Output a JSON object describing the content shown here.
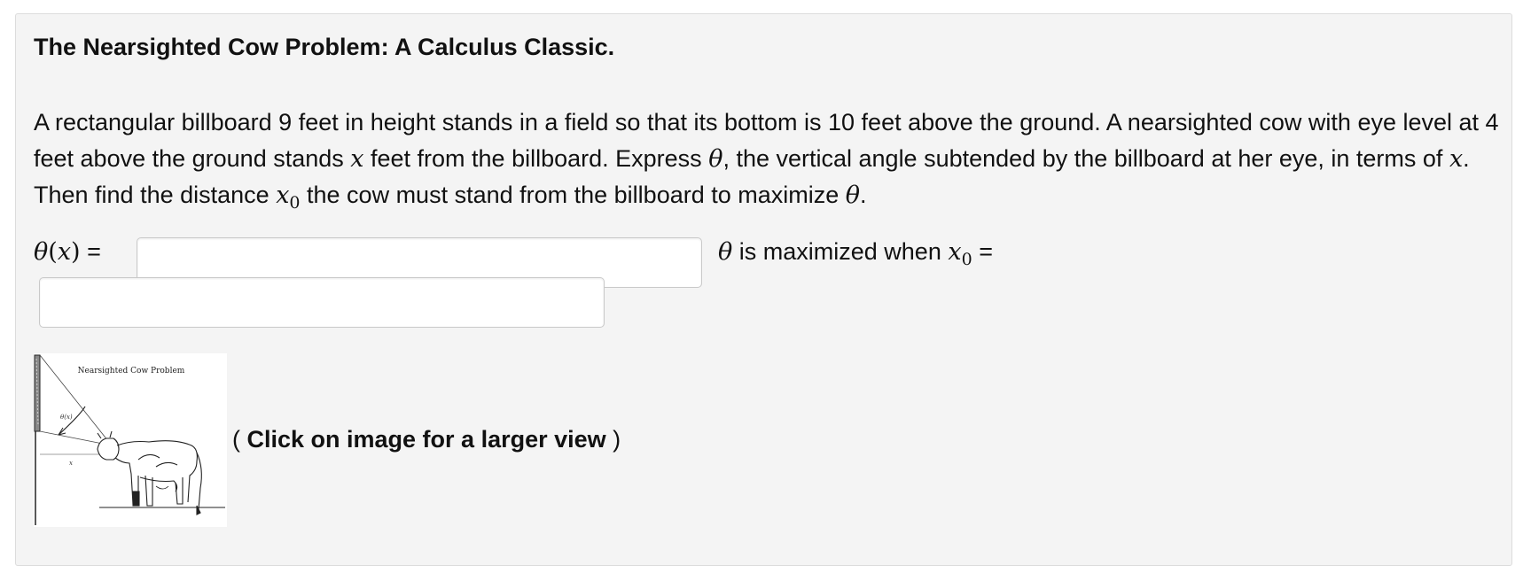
{
  "problem": {
    "title": "The Nearsighted Cow Problem: A Calculus Classic.",
    "statement_parts": {
      "p1": "A rectangular billboard 9 feet in height stands in a field so that its bottom is 10 feet above the ground. A nearsighted cow with eye level at 4 feet above the ground stands ",
      "x1": "x",
      "p2": " feet from the billboard. Express ",
      "theta1": "θ",
      "p3": ", the vertical angle subtended by the billboard at her eye, in terms of ",
      "x2": "x",
      "p4": ". Then find the distance ",
      "x0_var": "x",
      "x0_sub": "0",
      "p5": " the cow must stand from the billboard to maximize ",
      "theta2": "θ",
      "p6": "."
    }
  },
  "answers": {
    "theta_label": {
      "theta": "θ",
      "open": "(",
      "x": "x",
      "close": ")",
      "eq": " ="
    },
    "theta_value": "",
    "x0_label": {
      "theta": "θ",
      "text": " is maximized when ",
      "x": "x",
      "sub": "0",
      "eq": " ="
    },
    "x0_value": ""
  },
  "figure": {
    "caption": "Nearsighted Cow Problem",
    "theta_label": "θ(x)",
    "x_label": "x",
    "click_open": "( ",
    "click_bold": "Click on image for a larger view",
    "click_close": " )"
  }
}
